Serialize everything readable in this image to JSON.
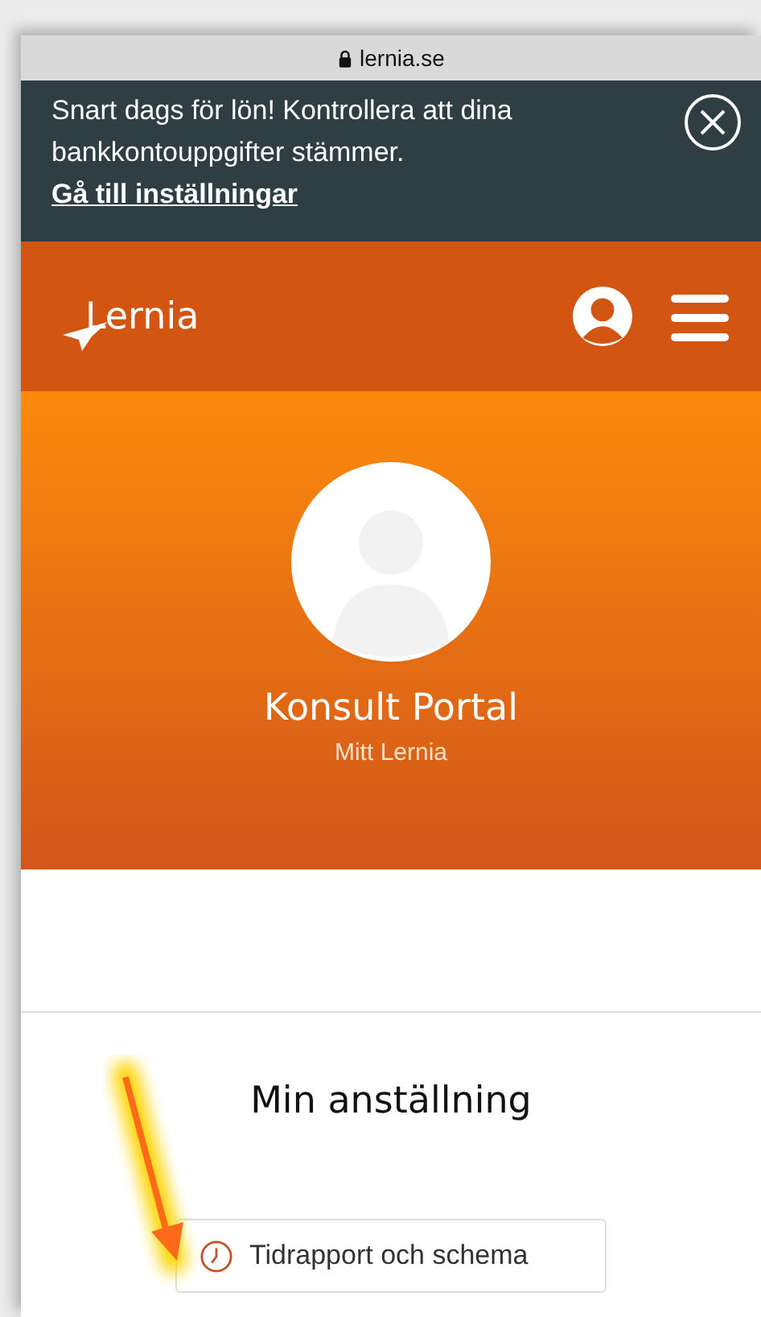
{
  "address_bar": {
    "url": "lernia.se",
    "secure": true
  },
  "banner": {
    "message": "Snart dags för lön! Kontrollera att dina bankkontouppgifter stämmer.",
    "link": "Gå till inställningar"
  },
  "header": {
    "logo": "Lernia"
  },
  "hero": {
    "title": "Konsult Portal",
    "subtitle": "Mitt Lernia"
  },
  "section": {
    "title": "Min anställning",
    "buttons": [
      {
        "label": "Tidrapport och schema"
      }
    ]
  },
  "annotation": {
    "kind": "arrow"
  }
}
